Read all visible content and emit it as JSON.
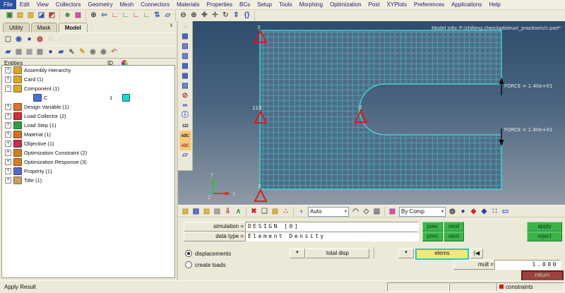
{
  "menu": {
    "items": [
      {
        "label": "File",
        "cls": "sel"
      },
      {
        "label": "Edit"
      },
      {
        "label": "View"
      },
      {
        "label": "Collectors"
      },
      {
        "label": "Geometry"
      },
      {
        "label": "Mesh"
      },
      {
        "label": "Connectors"
      },
      {
        "label": "Materials"
      },
      {
        "label": "Properties"
      },
      {
        "label": "BCs"
      },
      {
        "label": "Setup"
      },
      {
        "label": "Tools"
      },
      {
        "label": "Morphing"
      },
      {
        "label": "Optimization"
      },
      {
        "label": "Post"
      },
      {
        "label": "XYPlots"
      },
      {
        "label": "Preferences"
      },
      {
        "label": "Applications"
      },
      {
        "label": "Help"
      }
    ]
  },
  "top_toolbar": {
    "g1": [
      {
        "n": "new-session-icon",
        "g": "▣",
        "c": "#3a7a3a"
      },
      {
        "n": "open-model-icon",
        "g": "▤",
        "c": "#c89a28"
      },
      {
        "n": "save-model-icon",
        "g": "▥",
        "c": "#c89a28"
      },
      {
        "n": "import-icon",
        "g": "◪",
        "c": "#3a56b0"
      },
      {
        "n": "export-icon",
        "g": "◩",
        "c": "#b03a3a"
      }
    ],
    "g2": [
      {
        "n": "user-profile-icon",
        "g": "☻",
        "c": "#2f8f2f"
      },
      {
        "n": "color-palette-icon",
        "g": "▦",
        "c": "#c04a9a"
      }
    ],
    "g3": [
      {
        "n": "zoom-window-icon",
        "g": "⊕",
        "c": "#555555"
      },
      {
        "n": "previous-view-icon",
        "g": "⇦",
        "c": "#3a56b0"
      },
      {
        "n": "view-xy-front-icon",
        "g": "∟",
        "c": "#cc2b2b"
      },
      {
        "n": "view-xy-back-icon",
        "g": "∟",
        "c": "#2f8f2f"
      },
      {
        "n": "view-xz-icon",
        "g": "∟",
        "c": "#cc2b2b"
      },
      {
        "n": "view-yz-icon",
        "g": "∟",
        "c": "#2f8f2f"
      },
      {
        "n": "view-rotate-icon",
        "g": "⇅",
        "c": "#3a56b0"
      },
      {
        "n": "view-plane-icon",
        "g": "▱",
        "c": "#3a56b0"
      }
    ],
    "g4": [
      {
        "n": "zoom-out-icon",
        "g": "⊖",
        "c": "#555555"
      },
      {
        "n": "zoom-in-icon",
        "g": "⊕",
        "c": "#555555"
      },
      {
        "n": "center-view-icon",
        "g": "✚",
        "c": "#555555"
      },
      {
        "n": "pan-icon",
        "g": "✛",
        "c": "#555555"
      },
      {
        "n": "rotate-view-icon",
        "g": "↻",
        "c": "#555555"
      },
      {
        "n": "fit-view-icon",
        "g": "⇕",
        "c": "#3a56b0"
      },
      {
        "n": "brackets-icon",
        "g": "{}",
        "c": "#3a56b0"
      }
    ]
  },
  "left_panel": {
    "tabs": [
      {
        "label": "Utility"
      },
      {
        "label": "Mask"
      },
      {
        "label": "Model",
        "cls": "active"
      }
    ],
    "close_label": "x",
    "toolbar_row1": [
      {
        "n": "display-options-icon",
        "g": "▢",
        "c": "#666666"
      },
      {
        "n": "entity-links-icon",
        "g": "◉",
        "c": "#3a56b0"
      },
      {
        "n": "sphere-blue-icon",
        "g": "●",
        "c": "#2a3f9f"
      },
      {
        "n": "note-flag-icon",
        "g": "◍",
        "c": "#b03a3a"
      },
      {
        "n": "sphere-gray-icon",
        "g": "◌",
        "c": "#888888"
      },
      {
        "n": "sphere-ghost1-icon",
        "g": "◌",
        "c": "#aaaaaa"
      },
      {
        "n": "sphere-ghost2-icon",
        "g": "◌",
        "c": "#bbbbbb"
      }
    ],
    "toolbar_row2": [
      {
        "n": "component-view-icon",
        "g": "▰",
        "c": "#3a56b0"
      },
      {
        "n": "check-all-icon",
        "g": "▦",
        "c": "#888888"
      },
      {
        "n": "check-none-icon",
        "g": "▦",
        "c": "#999999"
      },
      {
        "n": "check-reverse-icon",
        "g": "▦",
        "c": "#888888"
      },
      {
        "n": "sphere-menu-icon",
        "g": "●",
        "c": "#2a3f9f"
      },
      {
        "n": "plate-menu-icon",
        "g": "▰",
        "c": "#3a56b0"
      },
      {
        "n": "pointer-icon",
        "g": "⇖",
        "c": "#555555"
      },
      {
        "n": "highlight-pen-icon",
        "g": "✎",
        "c": "#c8a428"
      },
      {
        "n": "eye-plusminus-icon",
        "g": "◉",
        "c": "#777777"
      },
      {
        "n": "eye-one-icon",
        "g": "◉",
        "c": "#777777"
      },
      {
        "n": "undo-icon",
        "g": "↶",
        "c": "#bb7777"
      }
    ],
    "header": {
      "entities": "Entities",
      "id": "ID"
    },
    "tree": [
      {
        "label": "Assembly Hierarchy",
        "exp": "+",
        "c": "#d8a530"
      },
      {
        "label": "Card (1)",
        "exp": "+",
        "c": "#d8a530"
      },
      {
        "label": "Component (1)",
        "exp": "−",
        "c": "#d8a530"
      },
      {
        "label": "C",
        "exp": "",
        "c": "#4a6fd4",
        "id": "1",
        "sw": "#00dede",
        "cls": "child"
      },
      {
        "label": "Design Variable (1)",
        "exp": "+",
        "c": "#e07030"
      },
      {
        "label": "Load Collector (2)",
        "exp": "+",
        "c": "#d03030"
      },
      {
        "label": "Load Step (1)",
        "exp": "+",
        "c": "#30a040"
      },
      {
        "label": "Material (1)",
        "exp": "+",
        "c": "#d07020"
      },
      {
        "label": "Objective (1)",
        "exp": "+",
        "c": "#c03050"
      },
      {
        "label": "Optimization Constraint (2)",
        "exp": "+",
        "c": "#d08020"
      },
      {
        "label": "Optimization Response (3)",
        "exp": "+",
        "c": "#d08020"
      },
      {
        "label": "Property (1)",
        "exp": "+",
        "c": "#5868c8"
      },
      {
        "label": "Title (1)",
        "exp": "+",
        "c": "#c8a060"
      }
    ]
  },
  "graphics": {
    "model_info": "Model Info: F:/zhifeng.chen/optistruct_practise/c/c.part*",
    "force_labels": [
      "FORCE = 1.40e+01",
      "FORCE = 1.40e+01"
    ],
    "constraint_labels": [
      "3",
      "123",
      "2",
      "3"
    ],
    "axis_labels": {
      "x": "X",
      "y": "Y",
      "z": "Z"
    },
    "mesh_color": "#3fe3e3",
    "constraint_color": "#e01414",
    "side_toolbar": [
      {
        "n": "toolbar-grip",
        "g": "····",
        "c": "#998f6a",
        "cl": "txt"
      },
      {
        "n": "mesh-shaded-icon",
        "g": "▦",
        "c": "#3a56b0"
      },
      {
        "n": "mesh-edges-icon",
        "g": "▧",
        "c": "#3a56b0"
      },
      {
        "n": "mesh-wire-icon",
        "g": "▨",
        "c": "#3a56b0"
      },
      {
        "n": "mesh-hidden-icon",
        "g": "▩",
        "c": "#3a56b0"
      },
      {
        "n": "mesh-transparent-icon",
        "g": "▦",
        "c": "#3a56b0"
      },
      {
        "n": "mesh-feature-icon",
        "g": "▧",
        "c": "#3a56b0"
      },
      {
        "n": "section-cut-icon",
        "g": "⊘",
        "c": "#b03a3a"
      },
      {
        "n": "find-icon",
        "g": "∞",
        "c": "#2a3f9f"
      },
      {
        "n": "info-icon",
        "g": "ⓘ",
        "c": "#2a5fd0"
      },
      {
        "n": "numbers-label-icon",
        "g": "123",
        "c": "#333333",
        "cl": "txt"
      },
      {
        "n": "element-label-icon",
        "g": "ABC",
        "c": "#333333",
        "b": "#f7c97c",
        "cl": "txt"
      },
      {
        "n": "load-label-icon",
        "g": "ABC",
        "c": "#b03a3a",
        "b": "#f7c97c",
        "cl": "txt"
      },
      {
        "n": "plate-icon",
        "g": "▱",
        "c": "#3a56b0"
      }
    ]
  },
  "bottom_toolbar": {
    "caret": "▾",
    "auto_label": "Auto",
    "bycomp_label": "By Comp",
    "g1": [
      {
        "n": "open-folder-icon",
        "g": "▤",
        "c": "#c89a28"
      },
      {
        "n": "open-session-icon",
        "g": "▤",
        "c": "#2a3f9f"
      },
      {
        "n": "open-card-icon",
        "g": "▤",
        "c": "#c89a28"
      },
      {
        "n": "open-gray-icon",
        "g": "▤",
        "c": "#888888"
      },
      {
        "n": "import-load-icon",
        "g": "⇩",
        "c": "#b03a3a"
      },
      {
        "n": "script-icon",
        "g": "∧",
        "c": "#2f8f2f"
      }
    ],
    "g2": [
      {
        "n": "delete-icon",
        "g": "✖",
        "c": "#cc2222"
      },
      {
        "n": "organize-icon",
        "g": "❏",
        "c": "#777777"
      },
      {
        "n": "card-editor-icon",
        "g": "▤",
        "c": "#c89a28"
      },
      {
        "n": "translate-icon",
        "g": "∴",
        "c": "#b03a3a"
      }
    ],
    "selector_icon": {
      "n": "selector-mode-icon",
      "g": "◖",
      "c": "#7a5fd0"
    },
    "g3": [
      {
        "n": "lasso-icon",
        "g": "◠",
        "c": "#555555"
      },
      {
        "n": "box-select-icon",
        "g": "◇",
        "c": "#555555"
      },
      {
        "n": "cube-icon",
        "g": "▧",
        "c": "#666677"
      }
    ],
    "bycomp_icon": {
      "n": "bycomp-color-icon",
      "g": "▦",
      "c": "#c04a9a"
    },
    "g5": [
      {
        "n": "wireframe-sphere-icon",
        "g": "◍",
        "c": "#444455"
      },
      {
        "n": "shaded-sphere-icon",
        "g": "●",
        "c": "#2a3f9f"
      },
      {
        "n": "element-red-icon",
        "g": "◆",
        "c": "#cc2222"
      },
      {
        "n": "element-blue-icon",
        "g": "◆",
        "c": "#2a3f9f"
      },
      {
        "n": "dots-icon",
        "g": "∷",
        "c": "#2a3f9f"
      },
      {
        "n": "screen-icon",
        "g": "▭",
        "c": "#2a5fd0"
      }
    ]
  },
  "panel": {
    "caret": "▼",
    "reset_glyph": "|◀",
    "simulation_label": "simulation =",
    "simulation_value": "DESIGN [0]",
    "datatype_label": "data type =",
    "datatype_value": "Element Density",
    "prev": "prev",
    "next": "next",
    "apply": "apply",
    "reject": "reject",
    "radio1": "displacements",
    "radio2": "create loads",
    "total_disp": "total disp",
    "elems": "elems",
    "mult_label": "mult =",
    "mult_value": "1.000",
    "return_label": "return"
  },
  "status_bar": {
    "message": "Apply Result",
    "constraints_label": "constraints"
  }
}
